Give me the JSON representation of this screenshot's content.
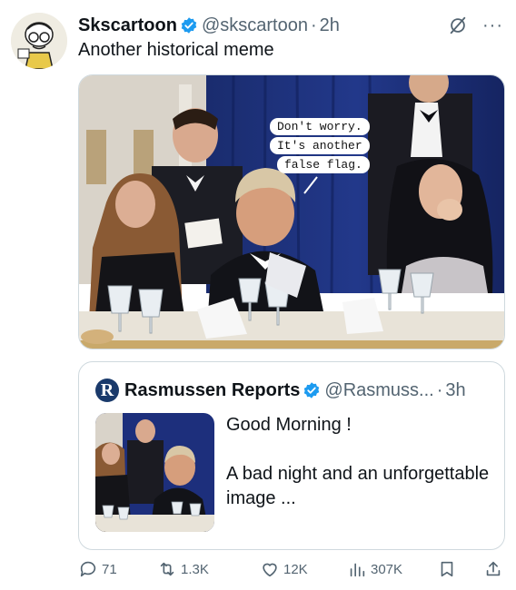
{
  "tweet": {
    "display_name": "Skscartoon",
    "handle": "@skscartoon",
    "separator": "·",
    "time": "2h",
    "text": "Another historical meme",
    "media": {
      "speech_bubble_lines": [
        "Don't worry.",
        "It's another",
        "false flag."
      ]
    }
  },
  "quote": {
    "logo_letter": "R",
    "display_name": "Rasmussen Reports",
    "handle": "@Rasmuss...",
    "separator": "·",
    "time": "3h",
    "text_line1": "Good Morning !",
    "text_line2": "A bad night and an unforgettable image ..."
  },
  "actions": {
    "replies": "71",
    "reposts": "1.3K",
    "likes": "12K",
    "views": "307K"
  },
  "colors": {
    "verified_blue": "#1d9bf0",
    "secondary_text": "#536471",
    "border": "#cfd9de",
    "curtain_blue": "#1c2f7a"
  },
  "icons": [
    "avatar-cartoon",
    "verified-badge-icon",
    "grok-icon",
    "more-icon",
    "reply-icon",
    "repost-icon",
    "like-icon",
    "views-icon",
    "bookmark-icon",
    "share-icon"
  ]
}
